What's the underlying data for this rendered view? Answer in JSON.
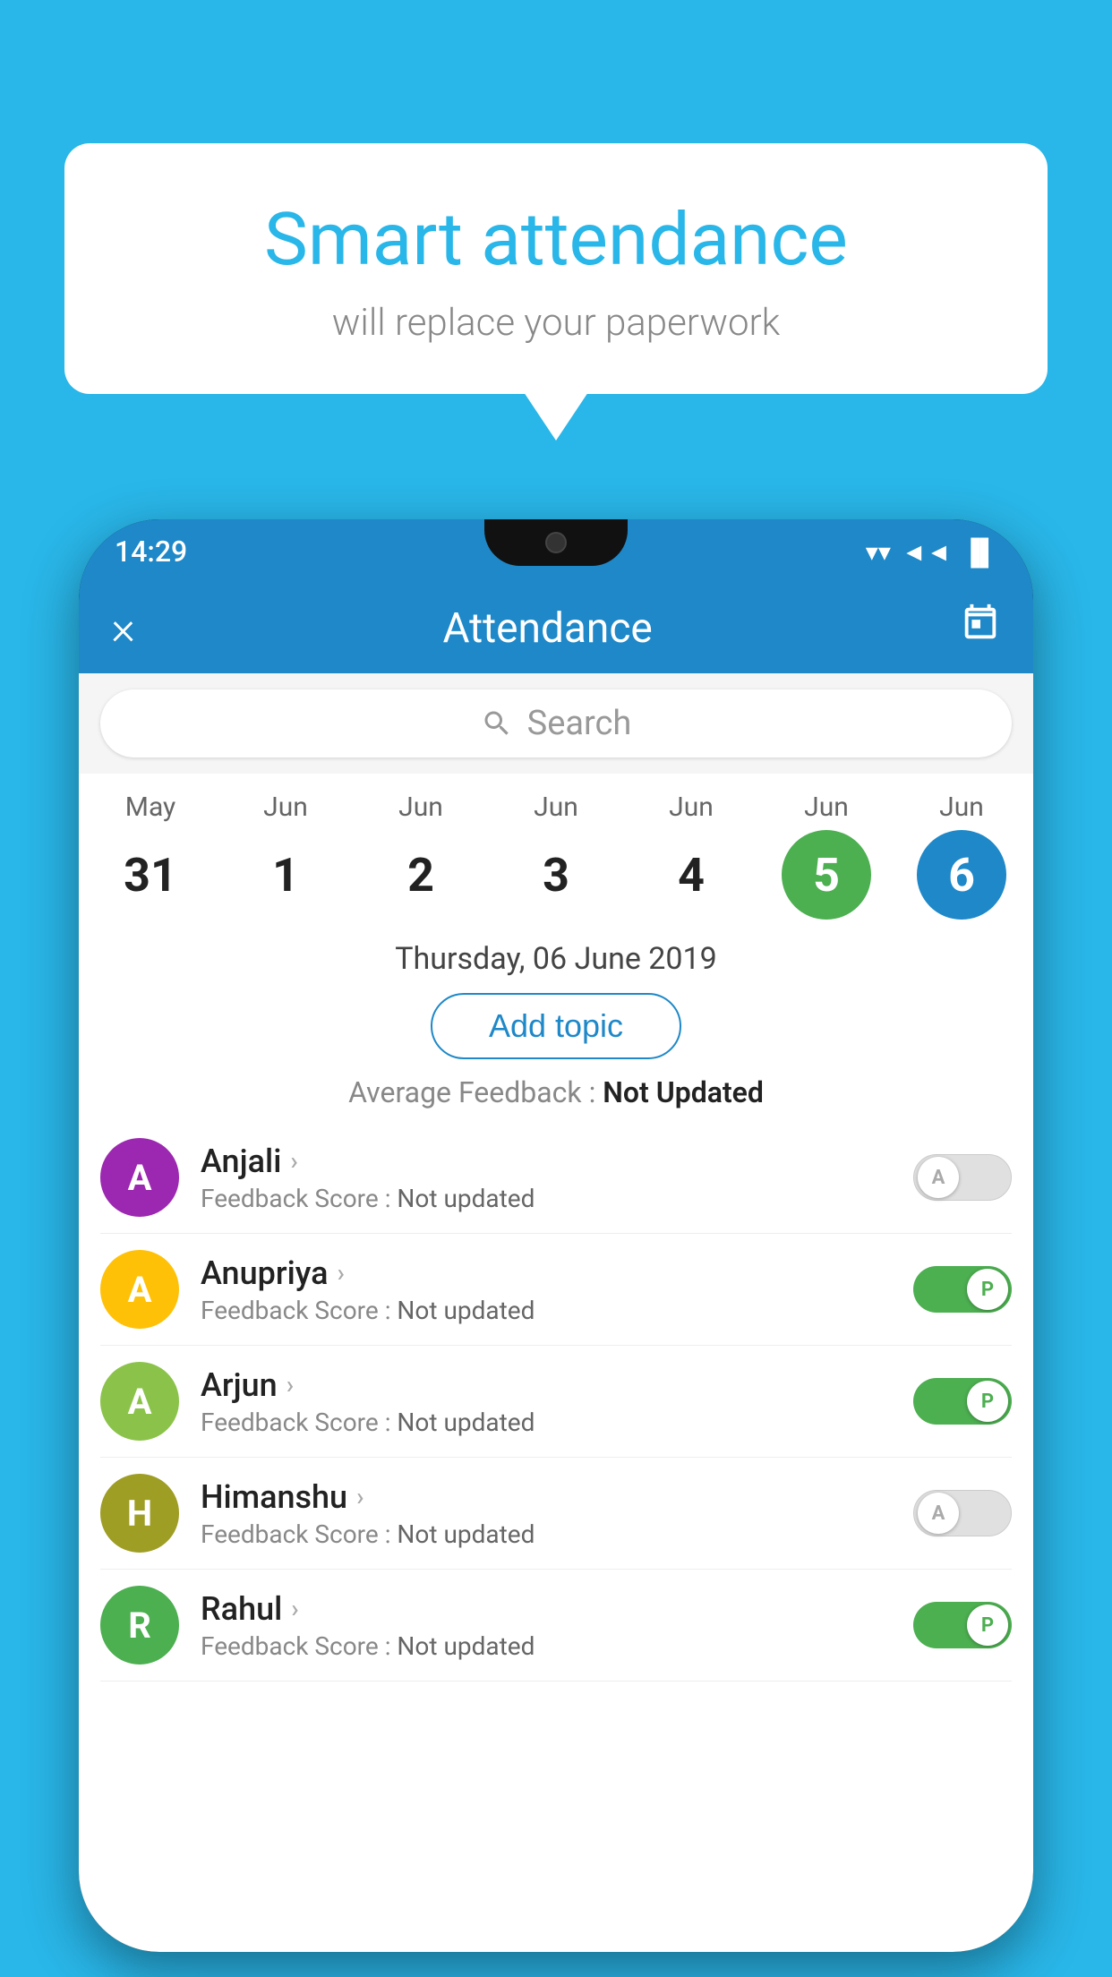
{
  "background_color": "#29B6E8",
  "bubble": {
    "title": "Smart attendance",
    "subtitle": "will replace your paperwork"
  },
  "phone": {
    "status_bar": {
      "time": "14:29",
      "wifi": "▲",
      "signal": "▲",
      "battery": "▐"
    },
    "header": {
      "close_label": "×",
      "title": "Attendance",
      "calendar_label": "📅"
    },
    "search": {
      "placeholder": "Search"
    },
    "calendar": {
      "days": [
        {
          "month": "May",
          "date": "31",
          "type": "normal"
        },
        {
          "month": "Jun",
          "date": "1",
          "type": "normal"
        },
        {
          "month": "Jun",
          "date": "2",
          "type": "normal"
        },
        {
          "month": "Jun",
          "date": "3",
          "type": "normal"
        },
        {
          "month": "Jun",
          "date": "4",
          "type": "normal"
        },
        {
          "month": "Jun",
          "date": "5",
          "type": "today"
        },
        {
          "month": "Jun",
          "date": "6",
          "type": "selected"
        }
      ]
    },
    "selected_date": "Thursday, 06 June 2019",
    "add_topic_label": "Add topic",
    "avg_feedback_label": "Average Feedback : ",
    "avg_feedback_value": "Not Updated",
    "students": [
      {
        "name": "Anjali",
        "avatar_letter": "A",
        "avatar_color": "#9C27B0",
        "feedback_label": "Feedback Score : ",
        "feedback_value": "Not updated",
        "toggle": "off",
        "toggle_letter": "A"
      },
      {
        "name": "Anupriya",
        "avatar_letter": "A",
        "avatar_color": "#FFC107",
        "feedback_label": "Feedback Score : ",
        "feedback_value": "Not updated",
        "toggle": "on",
        "toggle_letter": "P"
      },
      {
        "name": "Arjun",
        "avatar_letter": "A",
        "avatar_color": "#8BC34A",
        "feedback_label": "Feedback Score : ",
        "feedback_value": "Not updated",
        "toggle": "on",
        "toggle_letter": "P"
      },
      {
        "name": "Himanshu",
        "avatar_letter": "H",
        "avatar_color": "#9E9D24",
        "feedback_label": "Feedback Score : ",
        "feedback_value": "Not updated",
        "toggle": "off",
        "toggle_letter": "A"
      },
      {
        "name": "Rahul",
        "avatar_letter": "R",
        "avatar_color": "#4CAF50",
        "feedback_label": "Feedback Score : ",
        "feedback_value": "Not updated",
        "toggle": "on",
        "toggle_letter": "P"
      }
    ]
  }
}
